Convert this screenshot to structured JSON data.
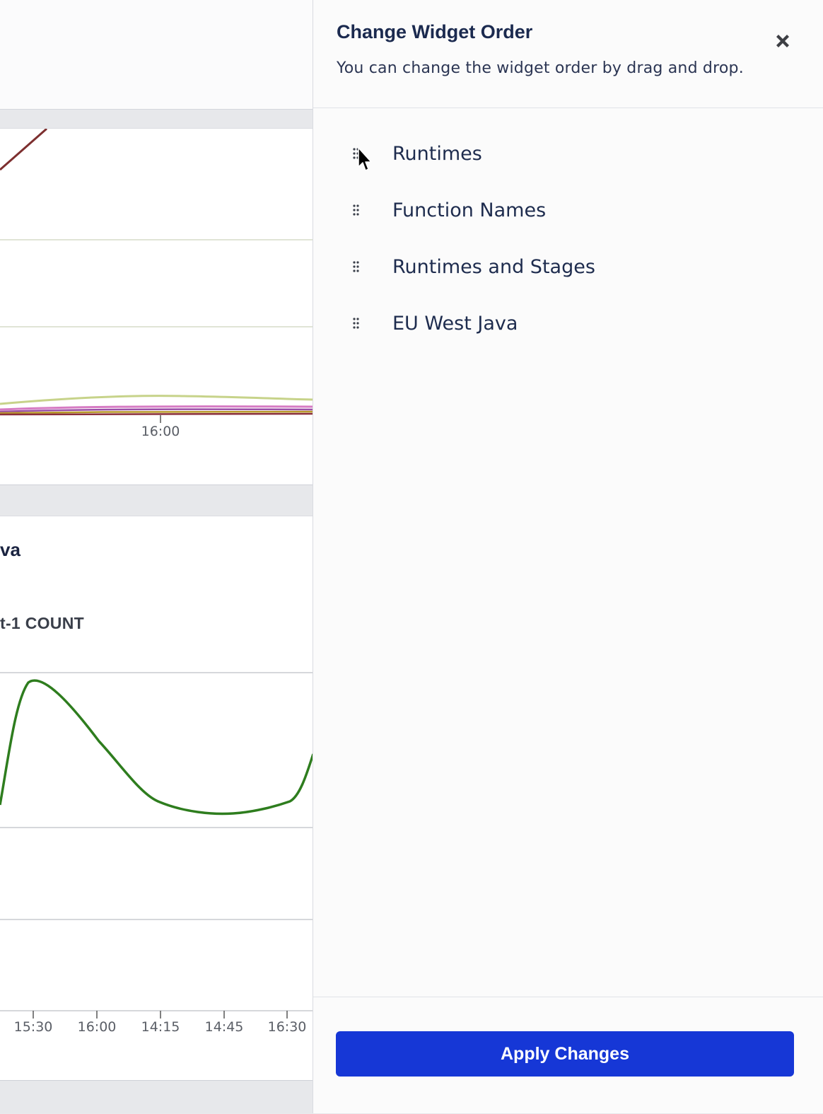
{
  "background": {
    "card1": {
      "x_tick_label": "16:00"
    },
    "card2": {
      "title_fragment": "va",
      "subtitle_fragment": "t-1 COUNT",
      "x_tick_labels": [
        "15:30",
        "16:00",
        "14:15",
        "14:45",
        "16:30"
      ]
    }
  },
  "drawer": {
    "title": "Change Widget Order",
    "description": "You can change the widget order by drag and drop.",
    "close_icon": "close-icon",
    "items": [
      {
        "label": "Runtimes",
        "icon": "drag-handle-icon"
      },
      {
        "label": "Function Names",
        "icon": "drag-handle-icon"
      },
      {
        "label": "Runtimes and Stages",
        "icon": "drag-handle-icon"
      },
      {
        "label": "EU West Java",
        "icon": "drag-handle-icon"
      }
    ],
    "apply_label": "Apply Changes"
  },
  "colors": {
    "accent": "#1637d6",
    "title": "#1b2a4f",
    "line_green": "#2e7d1e"
  }
}
